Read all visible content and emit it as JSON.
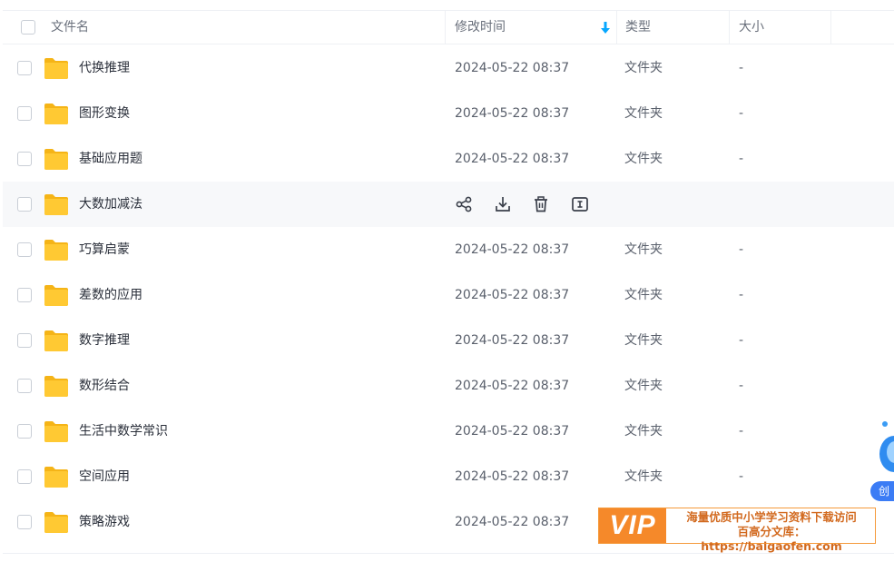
{
  "header": {
    "name_label": "文件名",
    "time_label": "修改时间",
    "type_label": "类型",
    "size_label": "大小"
  },
  "rows": [
    {
      "name": "代换推理",
      "time": "2024-05-22 08:37",
      "type": "文件夹",
      "size": "-"
    },
    {
      "name": "图形变换",
      "time": "2024-05-22 08:37",
      "type": "文件夹",
      "size": "-"
    },
    {
      "name": "基础应用题",
      "time": "2024-05-22 08:37",
      "type": "文件夹",
      "size": "-"
    },
    {
      "name": "大数加减法",
      "time": "",
      "type": "",
      "size": "",
      "hover": true
    },
    {
      "name": "巧算启蒙",
      "time": "2024-05-22 08:37",
      "type": "文件夹",
      "size": "-"
    },
    {
      "name": "差数的应用",
      "time": "2024-05-22 08:37",
      "type": "文件夹",
      "size": "-"
    },
    {
      "name": "数字推理",
      "time": "2024-05-22 08:37",
      "type": "文件夹",
      "size": "-"
    },
    {
      "name": "数形结合",
      "time": "2024-05-22 08:37",
      "type": "文件夹",
      "size": "-"
    },
    {
      "name": "生活中数学常识",
      "time": "2024-05-22 08:37",
      "type": "文件夹",
      "size": "-"
    },
    {
      "name": "空间应用",
      "time": "2024-05-22 08:37",
      "type": "文件夹",
      "size": "-"
    },
    {
      "name": "策略游戏",
      "time": "2024-05-22 08:37",
      "type": "",
      "size": ""
    }
  ],
  "hover_actions": [
    "share-icon",
    "download-icon",
    "delete-icon",
    "rename-icon"
  ],
  "watermark": {
    "logo": "VIP",
    "line1": "海量优质中小学学习资料下载访问",
    "line2": "百高分文库：https://baigaofen.com"
  },
  "float_button": {
    "label": "创"
  },
  "colors": {
    "accent": "#06a7ff",
    "folder": "#ffc933",
    "vip": "#f5892a"
  }
}
